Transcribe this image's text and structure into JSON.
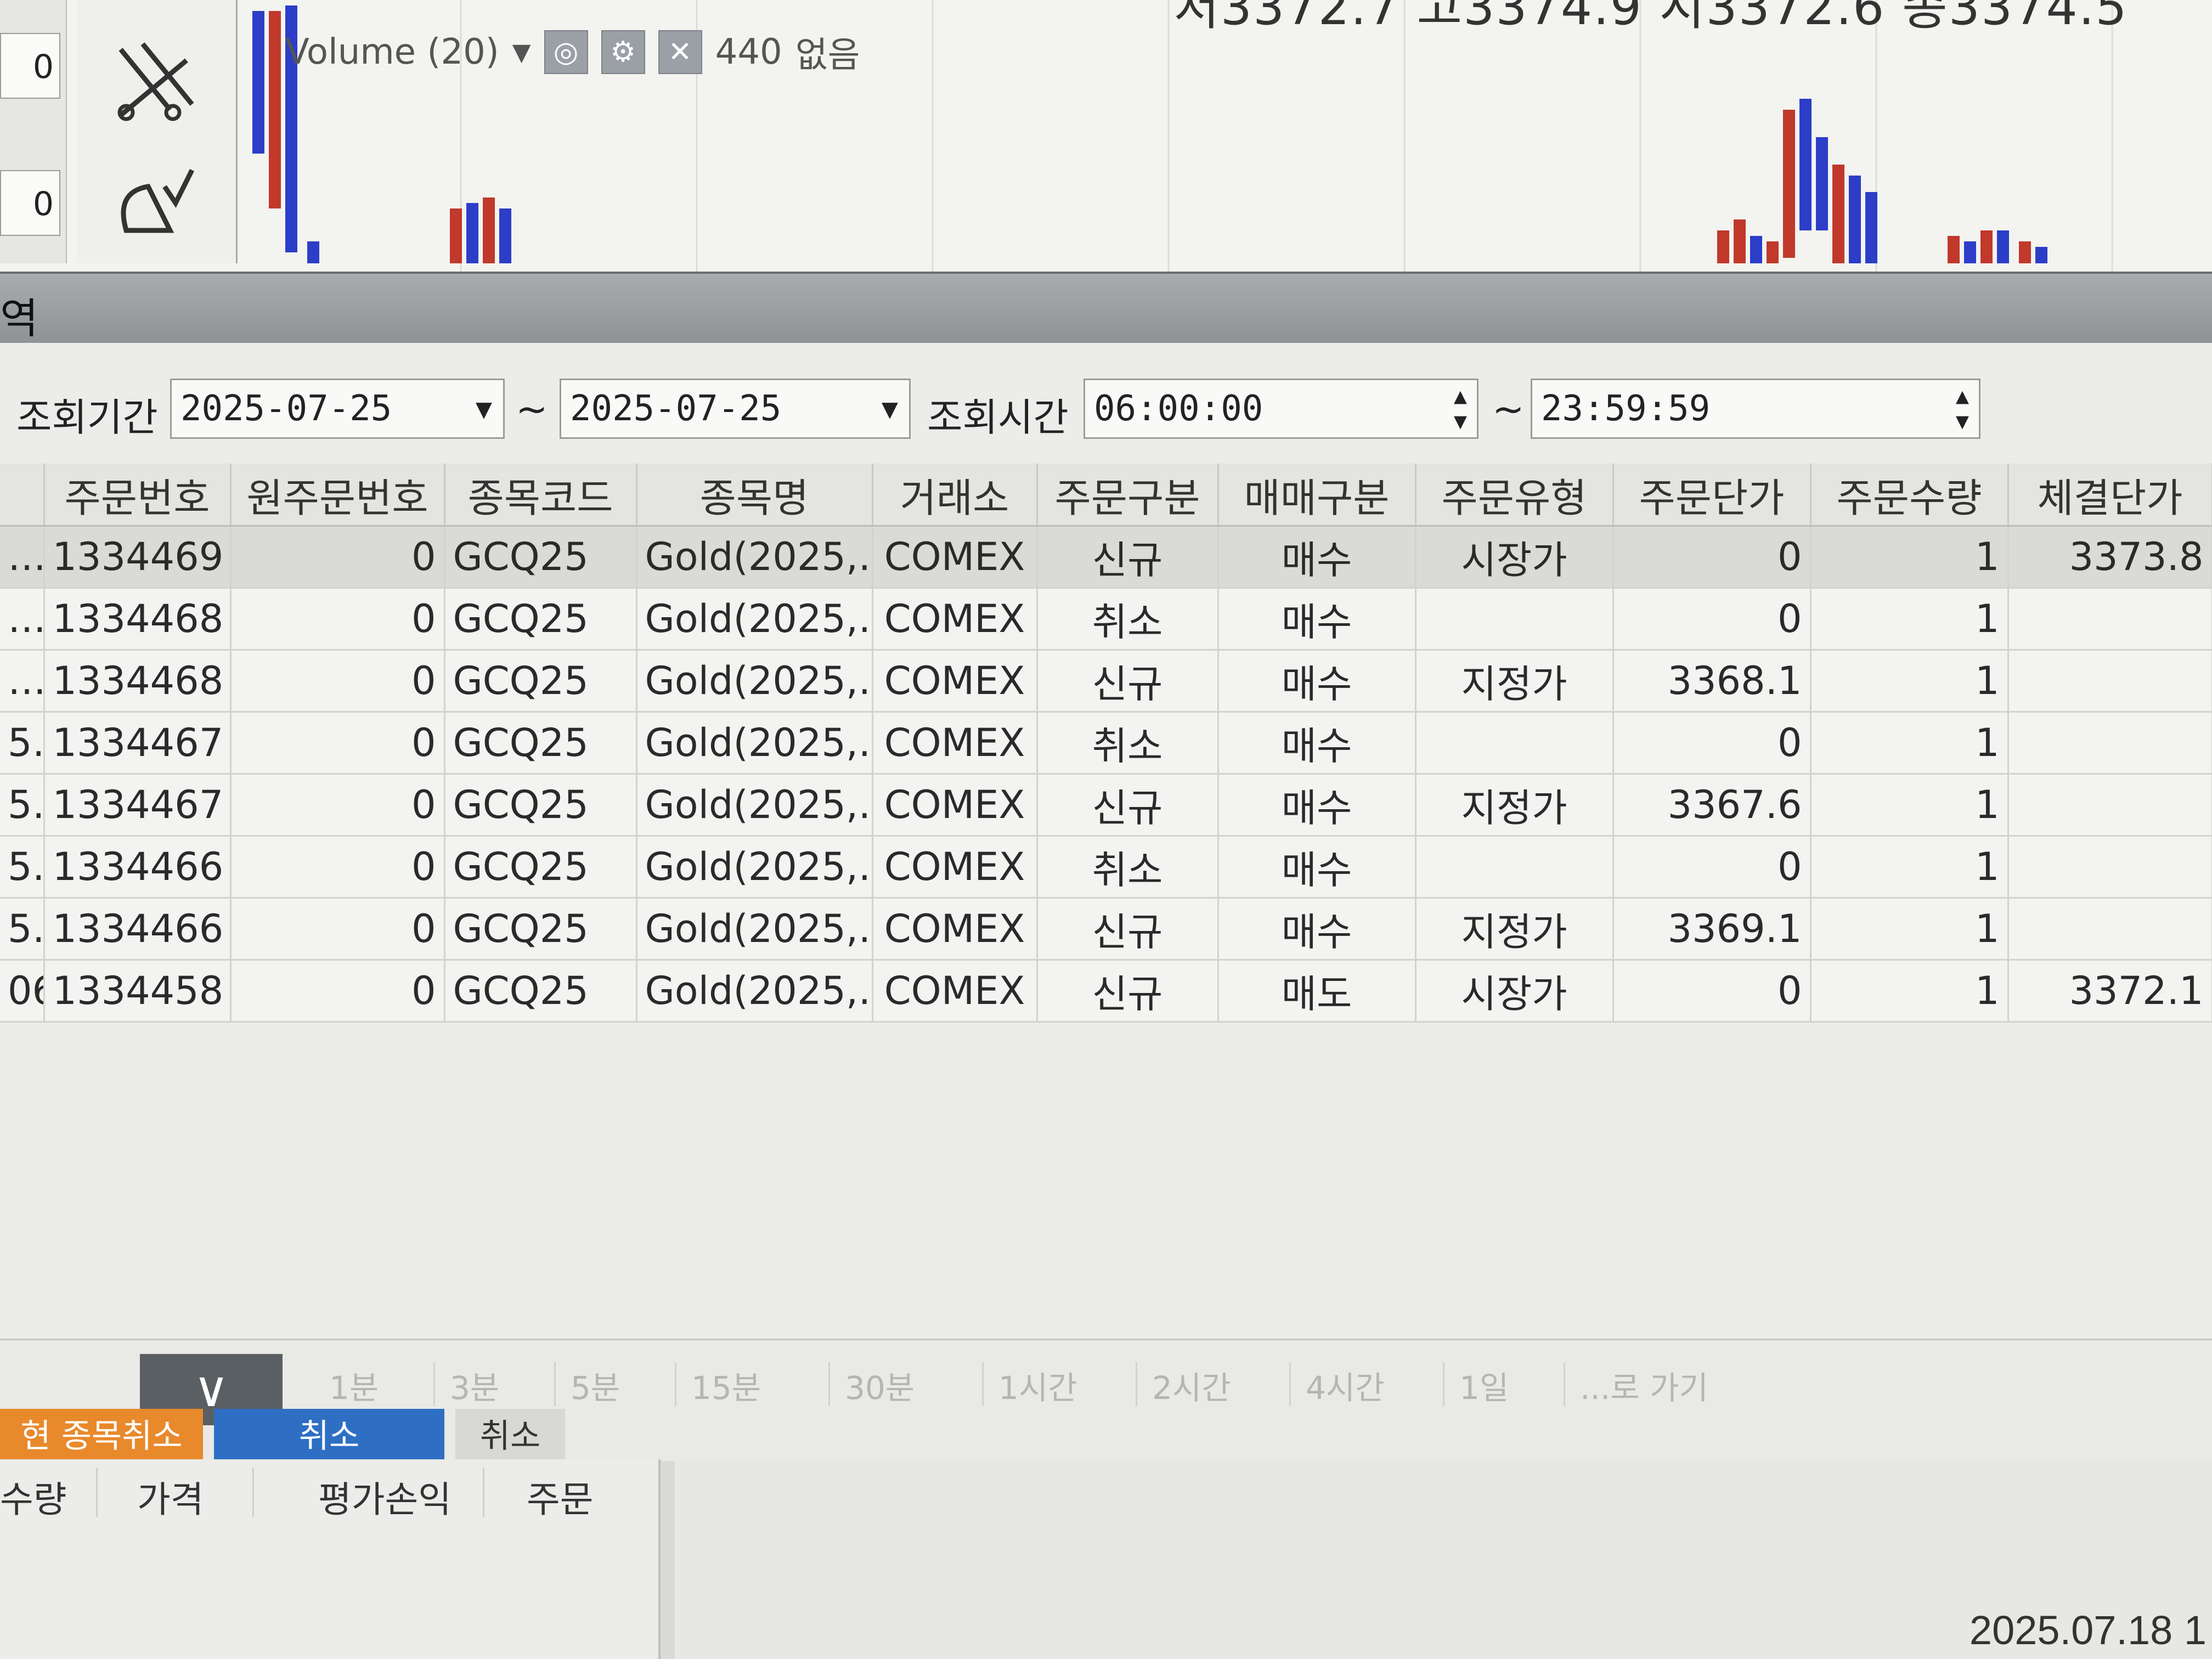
{
  "chart": {
    "indicator_label": "Volume (20)",
    "indicator_dropdown_icon": "caret-down-icon",
    "indicator_value": "440",
    "indicator_status": "없음",
    "ohlc_text": "저3372.7  고3374.9  시3372.6  종3374.5",
    "left_values": [
      "0",
      "0"
    ],
    "bar_colors": {
      "up": "#c0392b",
      "down": "#2c3ec7"
    }
  },
  "panel": {
    "title_fragment": "역"
  },
  "filter": {
    "period_label": "조회기간",
    "date_from": "2025-07-25",
    "date_to": "2025-07-25",
    "time_label": "조회시간",
    "time_from": "06:00:00",
    "time_to": "23:59:59",
    "tilde": "~"
  },
  "table": {
    "columns": [
      "주문번호",
      "원주문번호",
      "종목코드",
      "종목명",
      "거래소",
      "주문구분",
      "매매구분",
      "주문유형",
      "주문단가",
      "주문수량",
      "체결단가"
    ],
    "rows": [
      {
        "lead": "…",
        "order_no": "1334469",
        "orig_no": "0",
        "code": "GCQ25",
        "name": "Gold(2025,…",
        "exch": "COMEX",
        "kind": "신규",
        "side": "매수",
        "side_type": "buy",
        "type": "시장가",
        "price": "0",
        "qty": "1",
        "fill": "3373.8"
      },
      {
        "lead": "…",
        "order_no": "1334468",
        "orig_no": "0",
        "code": "GCQ25",
        "name": "Gold(2025,…",
        "exch": "COMEX",
        "kind": "취소",
        "side": "매수",
        "side_type": "buy",
        "type": "",
        "price": "0",
        "qty": "1",
        "fill": ""
      },
      {
        "lead": "…",
        "order_no": "1334468",
        "orig_no": "0",
        "code": "GCQ25",
        "name": "Gold(2025,…",
        "exch": "COMEX",
        "kind": "신규",
        "side": "매수",
        "side_type": "buy",
        "type": "지정가",
        "price": "3368.1",
        "qty": "1",
        "fill": ""
      },
      {
        "lead": "5…",
        "order_no": "1334467",
        "orig_no": "0",
        "code": "GCQ25",
        "name": "Gold(2025,…",
        "exch": "COMEX",
        "kind": "취소",
        "side": "매수",
        "side_type": "buy",
        "type": "",
        "price": "0",
        "qty": "1",
        "fill": ""
      },
      {
        "lead": "5…",
        "order_no": "1334467",
        "orig_no": "0",
        "code": "GCQ25",
        "name": "Gold(2025,…",
        "exch": "COMEX",
        "kind": "신규",
        "side": "매수",
        "side_type": "buy",
        "type": "지정가",
        "price": "3367.6",
        "qty": "1",
        "fill": ""
      },
      {
        "lead": "5…",
        "order_no": "1334466",
        "orig_no": "0",
        "code": "GCQ25",
        "name": "Gold(2025,…",
        "exch": "COMEX",
        "kind": "취소",
        "side": "매수",
        "side_type": "buy",
        "type": "",
        "price": "0",
        "qty": "1",
        "fill": ""
      },
      {
        "lead": "5…",
        "order_no": "1334466",
        "orig_no": "0",
        "code": "GCQ25",
        "name": "Gold(2025,…",
        "exch": "COMEX",
        "kind": "신규",
        "side": "매수",
        "side_type": "buy",
        "type": "지정가",
        "price": "3369.1",
        "qty": "1",
        "fill": ""
      },
      {
        "lead": "06…",
        "order_no": "1334458",
        "orig_no": "0",
        "code": "GCQ25",
        "name": "Gold(2025,…",
        "exch": "COMEX",
        "kind": "신규",
        "side": "매도",
        "side_type": "sell",
        "type": "시장가",
        "price": "0",
        "qty": "1",
        "fill": "3372.1"
      }
    ]
  },
  "timeframes": [
    "1분",
    "3분",
    "5분",
    "15분",
    "30분",
    "1시간",
    "2시간",
    "4시간",
    "1일",
    "...로 가기"
  ],
  "order_buttons": {
    "cancel_current": "현 종목취소",
    "cancel_all": "취소",
    "cancel_other": "취소",
    "colors": {
      "orange": "#e8892b",
      "blue": "#2e6fc4",
      "gray": "#bfbfbb"
    }
  },
  "positions": {
    "columns": [
      "수량",
      "가격",
      "평가손익",
      "주문"
    ]
  },
  "clock": "2025.07.18 1"
}
